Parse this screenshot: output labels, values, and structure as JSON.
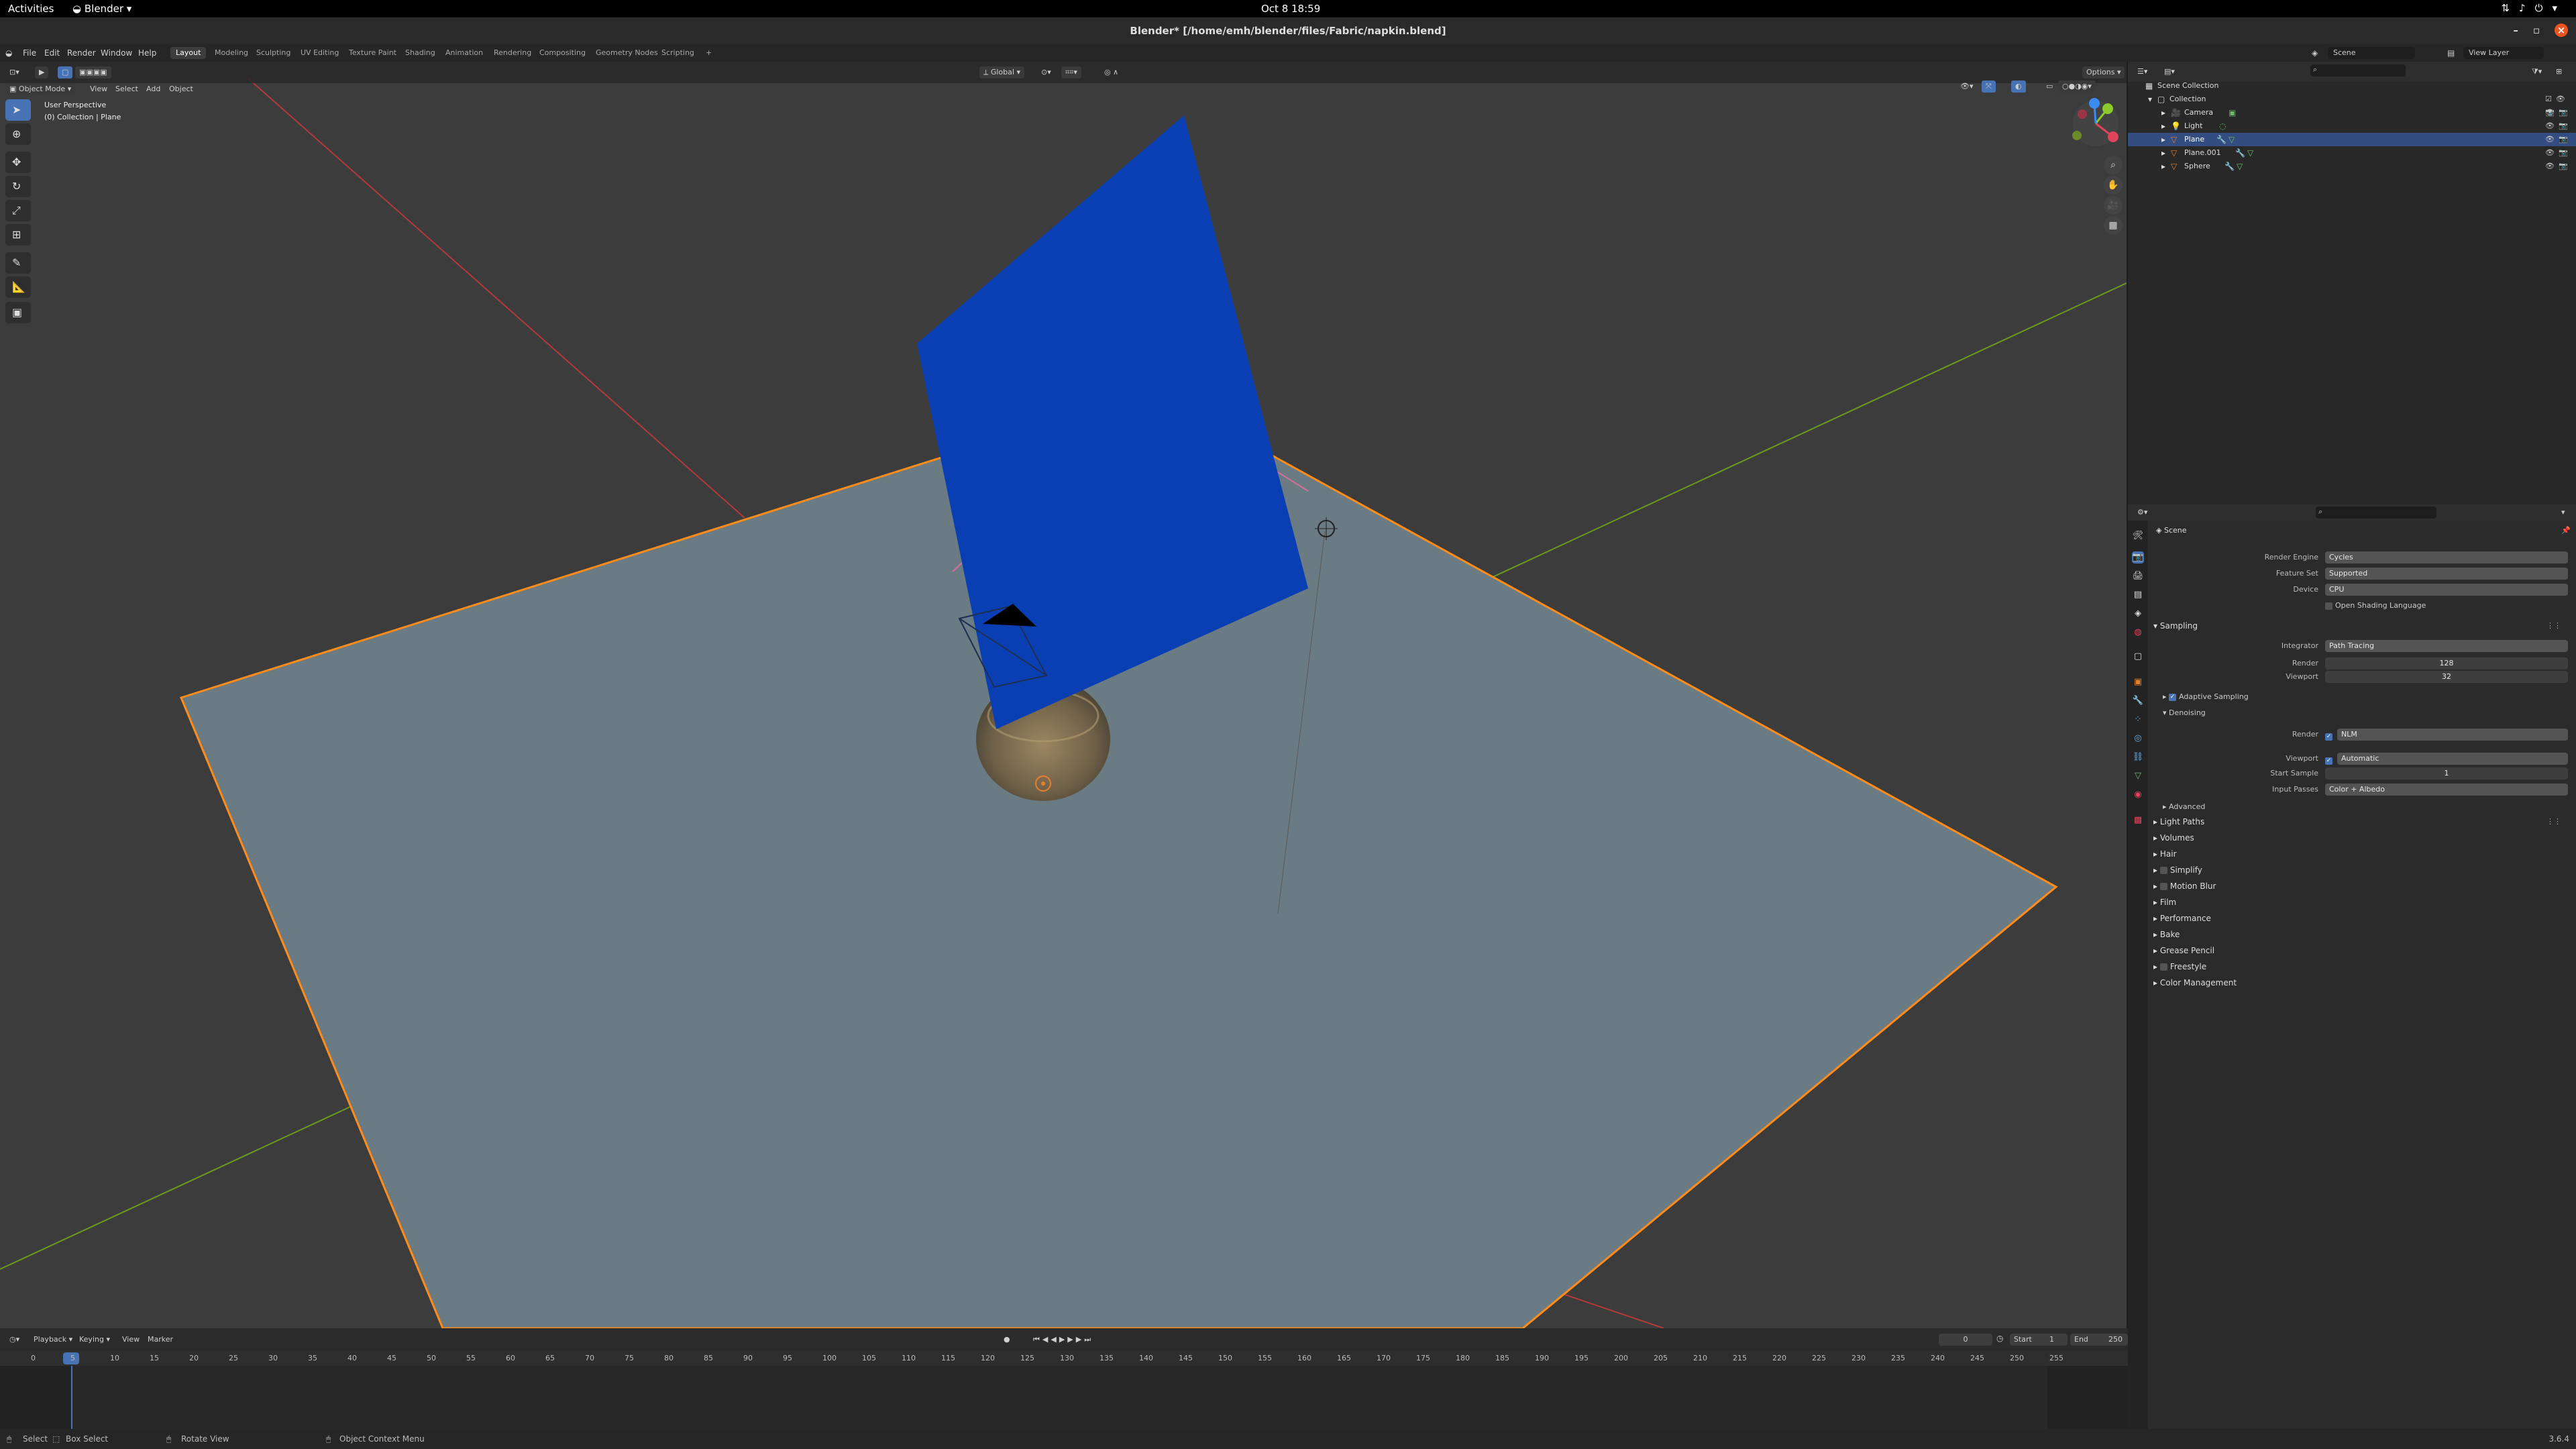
{
  "os_bar": {
    "activities": "Activities",
    "app_name": "Blender",
    "clock": "Oct 8  18:59"
  },
  "window": {
    "title": "Blender* [/home/emh/blender/files/Fabric/napkin.blend]"
  },
  "menu": [
    "File",
    "Edit",
    "Render",
    "Window",
    "Help"
  ],
  "workspaces": {
    "active": "Layout",
    "tabs": [
      "Layout",
      "Modeling",
      "Sculpting",
      "UV Editing",
      "Texture Paint",
      "Shading",
      "Animation",
      "Rendering",
      "Compositing",
      "Geometry Nodes",
      "Scripting"
    ],
    "add": "+"
  },
  "scene_selector": {
    "scene": "Scene",
    "view_layer": "View Layer"
  },
  "viewport": {
    "mode": "Object Mode",
    "menu": [
      "View",
      "Select",
      "Add",
      "Object"
    ],
    "transform_orientation": "Global",
    "options": "Options",
    "perspective": "User Perspective",
    "context": "(0) Collection | Plane",
    "colors": {
      "background": "#3c3c3c",
      "ground": "#6b7b83",
      "napkin": "#0a3fb4",
      "selection_outline": "#ff8c1a",
      "x_axis": "#b33a3a",
      "y_axis": "#6b9a1e"
    }
  },
  "timeline": {
    "menu": [
      "Playback",
      "Keying",
      "View",
      "Marker"
    ],
    "current_frame": "0",
    "start_label": "Start",
    "start": "1",
    "end_label": "End",
    "end": "250",
    "ticks": [
      "0",
      "5",
      "10",
      "15",
      "20",
      "25",
      "30",
      "35",
      "40",
      "45",
      "50",
      "55",
      "60",
      "65",
      "70",
      "75",
      "80",
      "85",
      "90",
      "95",
      "100",
      "105",
      "110",
      "115",
      "120",
      "125",
      "130",
      "135",
      "140",
      "145",
      "150",
      "155",
      "160",
      "165",
      "170",
      "175",
      "180",
      "185",
      "190",
      "195",
      "200",
      "205",
      "210",
      "215",
      "220",
      "225",
      "230",
      "235",
      "240",
      "245",
      "250",
      "255"
    ]
  },
  "statusbar": {
    "select": "Select",
    "box_select": "Box Select",
    "rotate_view": "Rotate View",
    "context_menu": "Object Context Menu",
    "version": "3.6.4"
  },
  "outliner": {
    "scene_collection": "Scene Collection",
    "collection": "Collection",
    "items": [
      {
        "name": "Camera",
        "icon": "camera-icon",
        "selected": false
      },
      {
        "name": "Light",
        "icon": "light-icon",
        "selected": false
      },
      {
        "name": "Plane",
        "icon": "mesh-icon",
        "selected": true
      },
      {
        "name": "Plane.001",
        "icon": "mesh-icon",
        "selected": false
      },
      {
        "name": "Sphere",
        "icon": "mesh-icon",
        "selected": false
      }
    ]
  },
  "properties": {
    "context": "Scene",
    "render_engine_label": "Render Engine",
    "render_engine": "Cycles",
    "feature_set_label": "Feature Set",
    "feature_set": "Supported",
    "device_label": "Device",
    "device": "CPU",
    "osl": "Open Shading Language",
    "sampling": "Sampling",
    "integrator_label": "Integrator",
    "integrator": "Path Tracing",
    "render_label": "Render",
    "render_samples": "128",
    "viewport_label": "Viewport",
    "viewport_samples": "32",
    "adaptive": "Adaptive Sampling",
    "denoising": "Denoising",
    "denoise_render_label": "Render",
    "denoise_render": "NLM",
    "denoise_viewport_label": "Viewport",
    "denoise_viewport": "Automatic",
    "start_sample_label": "Start Sample",
    "start_sample": "1",
    "input_passes_label": "Input Passes",
    "input_passes": "Color + Albedo",
    "advanced": "Advanced",
    "sections": [
      "Light Paths",
      "Volumes",
      "Hair",
      "Simplify",
      "Motion Blur",
      "Film",
      "Performance",
      "Bake",
      "Grease Pencil",
      "Freestyle",
      "Color Management"
    ]
  }
}
